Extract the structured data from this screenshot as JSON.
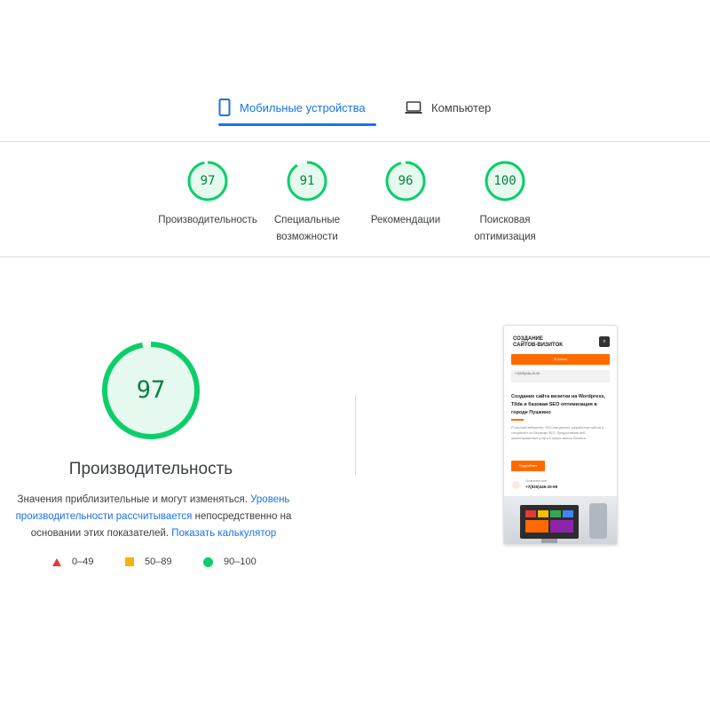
{
  "tabs": [
    {
      "label": "Мобильные устройства",
      "icon": "smartphone-icon",
      "active": true
    },
    {
      "label": "Компьютер",
      "icon": "laptop-icon",
      "active": false
    }
  ],
  "categories": [
    {
      "score": "97",
      "label_line1": "Производительность",
      "label_line2": ""
    },
    {
      "score": "91",
      "label_line1": "Специальные",
      "label_line2": "возможности"
    },
    {
      "score": "96",
      "label_line1": "Рекомендации",
      "label_line2": ""
    },
    {
      "score": "100",
      "label_line1": "Поисковая",
      "label_line2": "оптимизация"
    }
  ],
  "main": {
    "score": "97",
    "title": "Производительность",
    "desc_text1": "Значения приблизительные и могут изменяться.",
    "desc_link1": "Уровень производительности рассчитывается",
    "desc_text2": "непосредственно на основании этих показателей.",
    "desc_link2": "Показать калькулятор"
  },
  "legend": [
    {
      "range": "0–49",
      "shape": "triangle",
      "color": "#e53935"
    },
    {
      "range": "50–89",
      "shape": "square",
      "color": "#f4b400"
    },
    {
      "range": "90–100",
      "shape": "circle",
      "color": "#0cce6b"
    }
  ],
  "colors": {
    "accent": "#1a73e8",
    "pass_ring": "#0cce6b",
    "pass_text": "#0b8043",
    "brand_orange": "#ff6a00"
  },
  "phone_preview": {
    "logo_line1": "СОЗДАНИЕ",
    "logo_line2": "САЙТОВ-ВИЗИТОК",
    "menu_icon": "search-icon",
    "button_label": "☰ Меню",
    "contact_line1": "+7(925)446-20-99",
    "contact_line2": "Пушкино",
    "heading": "Создание сайта визитки на Wordpress, Tilda и базовая SEO оптимизация в городе Пушкино",
    "paragraph": "Я частный вебмастер, SEO-специалист, разработчик сайтов и специалист по базовому SEO. Предоставляю веб-ориентированные услуги в сфере малого бизнеса.",
    "cta_label": "Подробнее",
    "phone_label": "Позвоните мне",
    "phone_number": "+7(925)446-20-99"
  }
}
